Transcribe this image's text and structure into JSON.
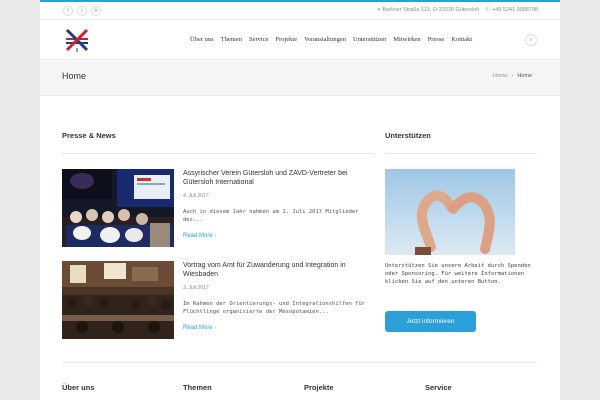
{
  "topbar": {
    "social_icons": [
      "facebook-icon",
      "twitter-icon",
      "email-icon"
    ],
    "social_glyphs": [
      "f",
      "t",
      "✉"
    ],
    "address": "Berliner Straße 113, D-33330 Gütersloh",
    "phone": "+49 5241 9988798"
  },
  "nav": {
    "items": [
      "Über uns",
      "Themen",
      "Service",
      "Projekte",
      "Veranstaltungen",
      "Unterstützen",
      "Mitwirken",
      "Presse",
      "Kontakt"
    ]
  },
  "titlebar": {
    "title": "Home",
    "breadcrumb": [
      "Home",
      "Home"
    ]
  },
  "news": {
    "heading": "Presse & News",
    "items": [
      {
        "title": "Assyrischer Verein Gütersloh und ZAVD-Vertreter bei Gütersloh International",
        "date": "4. Juli 2017",
        "excerpt": "Auch in diesem Jahr nahmen am 1. Juli 2017 Mitglieder des...",
        "more": "Read More"
      },
      {
        "title": "Vortrag vom Amt für Zuwanderung und Integration in Wiesbaden",
        "date": "3. Juli 2017",
        "excerpt": "Im Rahmen der Orientierungs- und Integrationshilfen für Flüchtlinge organisierte der Mesopotamien...",
        "more": "Read More"
      }
    ]
  },
  "support": {
    "heading": "Unterstützen",
    "text": "Unterstützen Sie unsere Arbeit durch Spenden oder Sponsoring. Für weitere Informationen klicken Sie auf den unteren Button.",
    "button": "Jetzt informieren"
  },
  "footer": {
    "columns": [
      "Über uns",
      "Themen",
      "Projekte",
      "Service"
    ]
  },
  "colors": {
    "accent": "#2a9fd8",
    "page_bg": "#e9e9e9"
  }
}
